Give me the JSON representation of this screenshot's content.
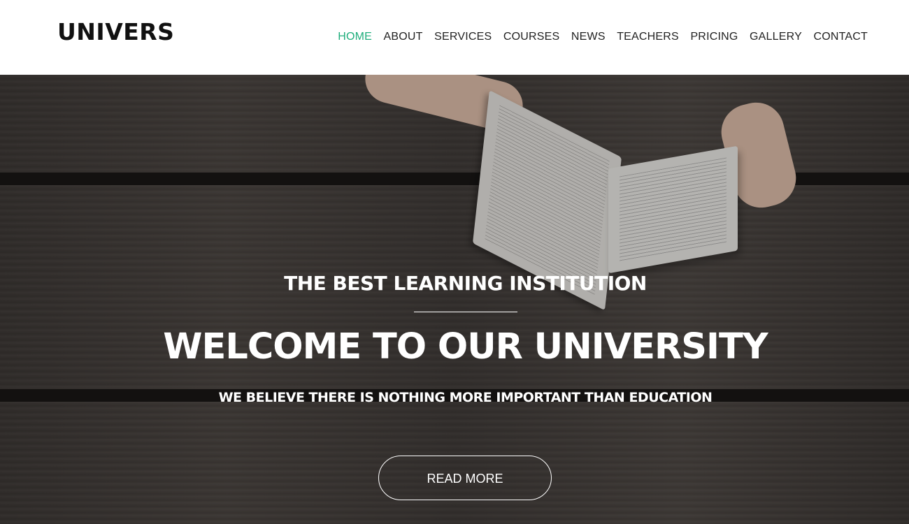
{
  "header": {
    "logo": "UNIVERS",
    "nav": [
      {
        "label": "HOME",
        "active": true
      },
      {
        "label": "ABOUT",
        "active": false
      },
      {
        "label": "SERVICES",
        "active": false
      },
      {
        "label": "COURSES",
        "active": false
      },
      {
        "label": "NEWS",
        "active": false
      },
      {
        "label": "TEACHERS",
        "active": false
      },
      {
        "label": "PRICING",
        "active": false
      },
      {
        "label": "GALLERY",
        "active": false
      },
      {
        "label": "CONTACT",
        "active": false
      }
    ],
    "active_color": "#1fae7c"
  },
  "hero": {
    "kicker": "THE BEST LEARNING INSTITUTION",
    "headline": "WELCOME TO OUR UNIVERSITY",
    "subline": "WE BELIEVE THERE IS NOTHING MORE IMPORTANT THAN EDUCATION",
    "button_label": "READ MORE",
    "background": "wooden-table-with-open-book-photo"
  }
}
